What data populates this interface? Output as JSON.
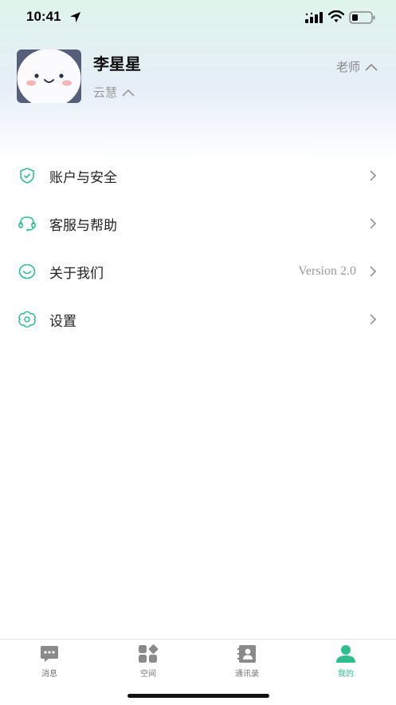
{
  "status_bar": {
    "time": "10:41",
    "icons": [
      "location-arrow-icon",
      "cellular-signal-icon",
      "wifi-icon",
      "battery-icon"
    ]
  },
  "profile": {
    "name": "李星星",
    "organization": "云慧",
    "role": "老师",
    "avatar_icon": "cute-face-avatar"
  },
  "menu": {
    "items": [
      {
        "label": "账户与安全",
        "icon": "shield-check-icon",
        "value": ""
      },
      {
        "label": "客服与帮助",
        "icon": "headset-icon",
        "value": ""
      },
      {
        "label": "关于我们",
        "icon": "smile-icon",
        "value": "Version 2.0"
      },
      {
        "label": "设置",
        "icon": "settings-flower-icon",
        "value": ""
      }
    ]
  },
  "tab_bar": {
    "tabs": [
      {
        "label": "消息",
        "icon": "message-icon",
        "active": false
      },
      {
        "label": "空间",
        "icon": "apps-grid-icon",
        "active": false
      },
      {
        "label": "通讯录",
        "icon": "contacts-book-icon",
        "active": false
      },
      {
        "label": "我的",
        "icon": "person-icon",
        "active": true
      }
    ]
  },
  "colors": {
    "accent": "#2fbf8c",
    "icon_inactive": "#8a8a8a",
    "gradient_top": "#dff4ea",
    "gradient_mid": "#e6eef8"
  }
}
